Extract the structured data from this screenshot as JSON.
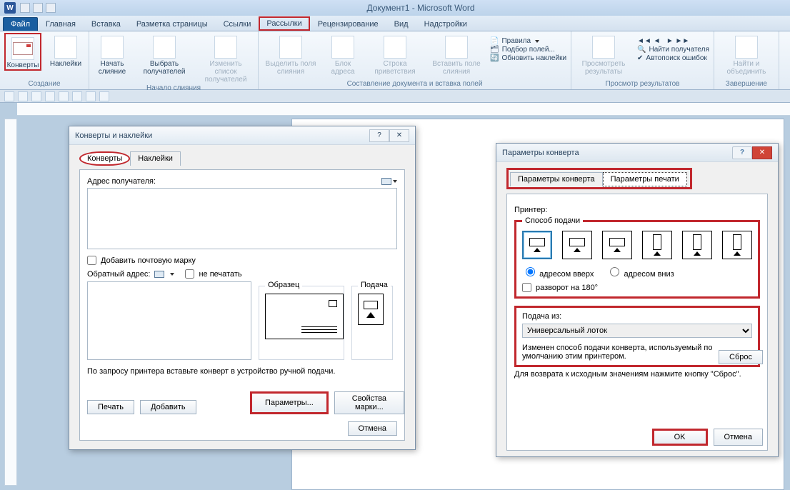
{
  "titlebar": {
    "title": "Документ1 - Microsoft Word"
  },
  "tabs": {
    "file": "Файл",
    "items": [
      "Главная",
      "Вставка",
      "Разметка страницы",
      "Ссылки",
      "Рассылки",
      "Рецензирование",
      "Вид",
      "Надстройки"
    ]
  },
  "ribbon": {
    "g1": {
      "label": "Создание",
      "envelopes": "Конверты",
      "labels": "Наклейки"
    },
    "g2": {
      "label": "Начало слияния",
      "start": "Начать слияние",
      "select": "Выбрать получателей",
      "edit": "Изменить список получателей"
    },
    "g3": {
      "label": "Составление документа и вставка полей",
      "b1": "Выделить поля слияния",
      "b2": "Блок адреса",
      "b3": "Строка приветствия",
      "b4": "Вставить поле слияния",
      "s1": "Правила",
      "s2": "Подбор полей...",
      "s3": "Обновить наклейки"
    },
    "g4": {
      "label": "Просмотр результатов",
      "preview": "Просмотреть результаты",
      "find": "Найти получателя",
      "check": "Автопоиск ошибок"
    },
    "g5": {
      "label": "Завершение",
      "finish": "Найти и объединить"
    }
  },
  "dialog1": {
    "title": "Конверты и наклейки",
    "tab_envelopes": "Конверты",
    "tab_labels": "Наклейки",
    "addr_label": "Адрес получателя:",
    "add_postage": "Добавить почтовую марку",
    "return_addr": "Обратный адрес:",
    "no_print": "не печатать",
    "sample": "Образец",
    "feed": "Подача",
    "instruction": "По запросу принтера вставьте конверт в устройство ручной подачи.",
    "print": "Печать",
    "add": "Добавить",
    "options": "Параметры...",
    "stamp_props": "Свойства марки...",
    "cancel": "Отмена"
  },
  "dialog2": {
    "title": "Параметры конверта",
    "tab_env": "Параметры конверта",
    "tab_print": "Параметры  печати",
    "printer_lbl": "Принтер:",
    "feed_method": "Способ подачи",
    "face_up": "адресом вверх",
    "face_down": "адресом вниз",
    "rotate": "разворот на 180°",
    "feed_from": "Подача из:",
    "tray": "Универсальный лоток",
    "note": "Изменен способ подачи конверта, используемый по умолчанию этим принтером.",
    "note2": "Для возврата к исходным значениям нажмите кнопку \"Сброс\".",
    "reset": "Сброс",
    "ok": "OK",
    "cancel": "Отмена"
  }
}
